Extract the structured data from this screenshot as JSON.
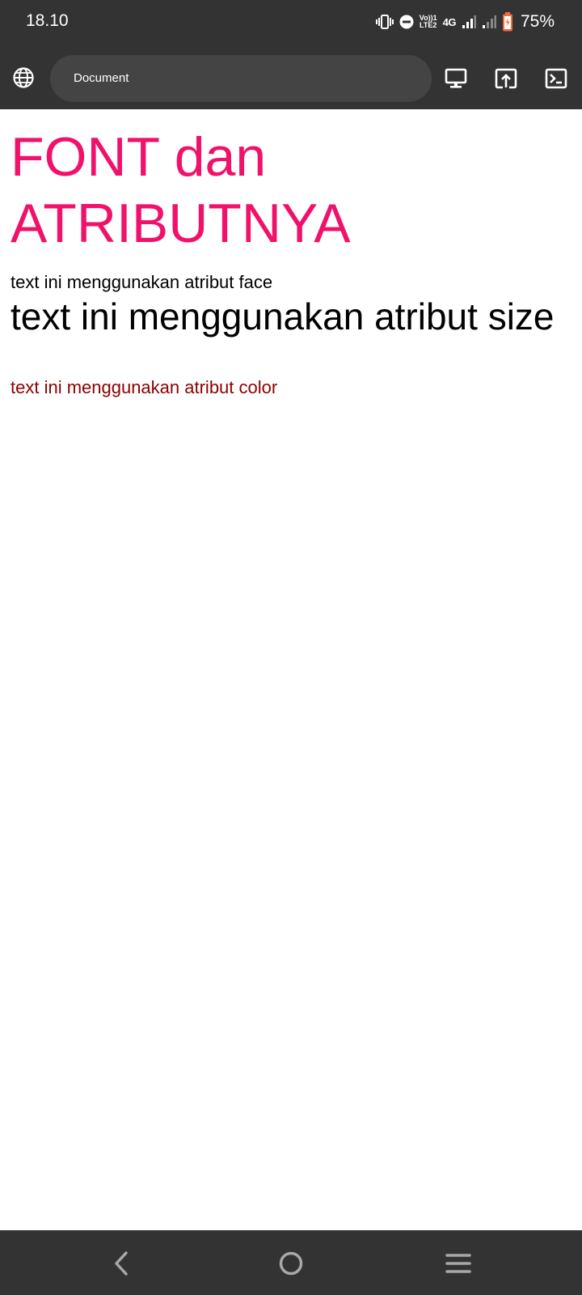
{
  "status_bar": {
    "time": "18.10",
    "network": "4G",
    "volte_top": "Vo))1",
    "volte_bottom": "LTE2",
    "battery": "75%"
  },
  "toolbar": {
    "url_title": "Document",
    "icons": [
      "globe-icon",
      "desktop-icon",
      "open-in-browser-icon",
      "console-icon"
    ]
  },
  "page": {
    "heading": "FONT dan ATRIBUTNYA",
    "face_text": "text ini menggunakan atribut face",
    "size_text": "text ini menggunakan atribut size",
    "color_text": "text ini menggunakan atribut color"
  },
  "nav_bar": {
    "icons": [
      "back-icon",
      "home-icon",
      "recents-icon"
    ]
  },
  "colors": {
    "bars": "#333333",
    "url_field": "#444444",
    "heading": "#f0116a",
    "color_text": "#8b0000"
  }
}
